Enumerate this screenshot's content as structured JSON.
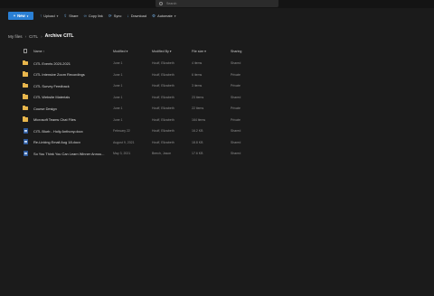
{
  "search": {
    "placeholder": "Search"
  },
  "commands": {
    "new_label": "New",
    "upload_label": "Upload",
    "share_label": "Share",
    "copy_link_label": "Copy link",
    "sync_label": "Sync",
    "download_label": "Download",
    "automate_label": "Automate"
  },
  "breadcrumb": {
    "root": "My files",
    "parent": "CITL",
    "current": "Archive CITL"
  },
  "columns": {
    "name": "Name",
    "modified": "Modified",
    "modified_by": "Modified By",
    "file_size": "File size",
    "sharing": "Sharing"
  },
  "files": [
    {
      "type": "folder",
      "name": "CITL Events 2020-2021",
      "modified": "June 1",
      "modified_by": "Houff, Elizabeth",
      "size": "4 items",
      "sharing": "Shared"
    },
    {
      "type": "folder",
      "name": "CITL Intensive Zoom Recordings",
      "modified": "June 1",
      "modified_by": "Houff, Elizabeth",
      "size": "6 items",
      "sharing": "Private"
    },
    {
      "type": "folder",
      "name": "CITL Survey Feedback",
      "modified": "June 1",
      "modified_by": "Houff, Elizabeth",
      "size": "3 items",
      "sharing": "Private"
    },
    {
      "type": "folder",
      "name": "CITL Website Materials",
      "modified": "June 1",
      "modified_by": "Houff, Elizabeth",
      "size": "23 items",
      "sharing": "Shared"
    },
    {
      "type": "folder",
      "name": "Course Design",
      "modified": "June 1",
      "modified_by": "Houff, Elizabeth",
      "size": "22 items",
      "sharing": "Private"
    },
    {
      "type": "folder",
      "name": "Microsoft Teams Chat Files",
      "modified": "June 1",
      "modified_by": "Houff, Elizabeth",
      "size": "164 items",
      "sharing": "Private"
    },
    {
      "type": "doc",
      "name": "CITL Blurb - Holly Anthony.docx",
      "modified": "February 22",
      "modified_by": "Houff, Elizabeth",
      "size": "16.2 KB",
      "sharing": "Shared"
    },
    {
      "type": "doc",
      "name": "Re-Linking Email Aug 18.docx",
      "modified": "August 9, 2021",
      "modified_by": "Houff, Elizabeth",
      "size": "18.8 KB",
      "sharing": "Shared"
    },
    {
      "type": "doc",
      "name": "So You Think You Can Learn Winner Annou...",
      "modified": "May 3, 2021",
      "modified_by": "Beech, Jason",
      "size": "17.6 KB",
      "sharing": "Shared"
    }
  ]
}
